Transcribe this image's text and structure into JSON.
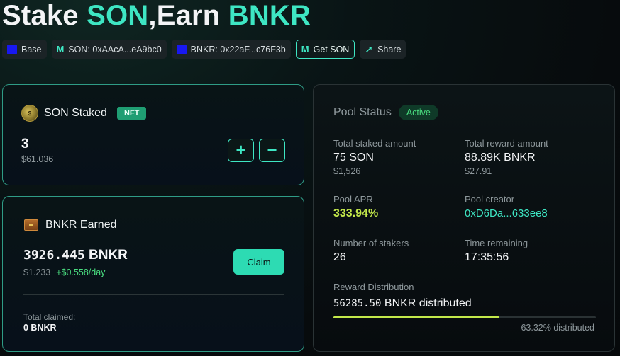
{
  "header": {
    "title_stake": "Stake",
    "title_token": "SON",
    "title_comma": ",",
    "title_earn": "Earn",
    "title_reward": "BNKR"
  },
  "chips": {
    "network": "Base",
    "son_address": "SON: 0xAAcA...eA9bc0",
    "bnkr_address": "BNKR: 0x22aF...c76F3b",
    "get_son": "Get SON",
    "share": "Share"
  },
  "stake_card": {
    "title": "SON Staked",
    "badge": "NFT",
    "amount": "3",
    "usd": "$61.036",
    "plus": "+",
    "minus": "−"
  },
  "earn_card": {
    "title": "BNKR Earned",
    "amount": "3926.445",
    "unit": "BNKR",
    "usd": "$1.233",
    "rate": "+$0.558/day",
    "claim_label": "Claim",
    "total_claimed_label": "Total claimed:",
    "total_claimed_value": "0 BNKR"
  },
  "pool": {
    "title": "Pool Status",
    "status": "Active",
    "total_staked_label": "Total staked amount",
    "total_staked_value": "75 SON",
    "total_staked_usd": "$1,526",
    "total_reward_label": "Total reward amount",
    "total_reward_value": "88.89K BNKR",
    "total_reward_usd": "$27.91",
    "apr_label": "Pool APR",
    "apr_value": "333.94%",
    "creator_label": "Pool creator",
    "creator_value": "0xD6Da...633ee8",
    "stakers_label": "Number of stakers",
    "stakers_value": "26",
    "time_label": "Time remaining",
    "time_value": "17:35:56",
    "dist_label": "Reward Distribution",
    "dist_amount": "56285.50",
    "dist_suffix": "BNKR distributed",
    "dist_percent_text": "63.32% distributed",
    "dist_fraction": 0.6332
  },
  "colors": {
    "accent": "#3ee6c3",
    "lime": "#c3e84a",
    "active_green": "#4ade80",
    "network_blue": "#1818f0"
  },
  "icons": {
    "network": "base-network-icon",
    "token": "son-logo-icon",
    "share": "share-arrow-icon",
    "son_coin": "son-coin-icon",
    "bnkr": "bnkr-chest-icon"
  }
}
